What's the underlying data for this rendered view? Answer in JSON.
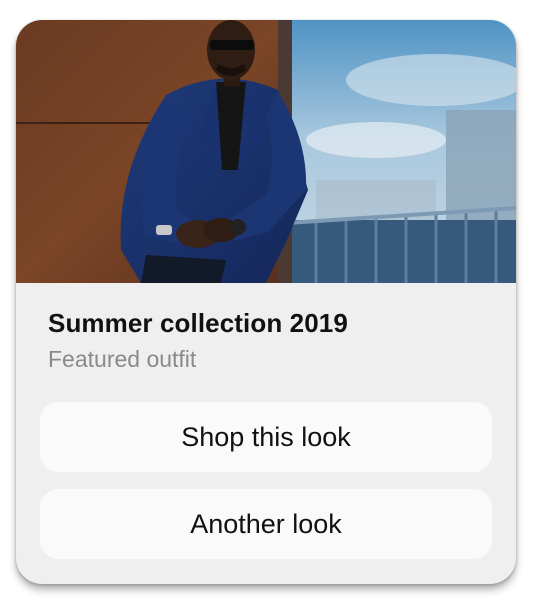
{
  "card": {
    "title": "Summer collection 2019",
    "subtitle": "Featured outfit"
  },
  "actions": {
    "primary_label": "Shop this look",
    "secondary_label": "Another look"
  },
  "colors": {
    "card_background": "#efefef",
    "button_background": "#fafafa",
    "title_text": "#111111",
    "subtitle_text": "#8a8a8a"
  }
}
